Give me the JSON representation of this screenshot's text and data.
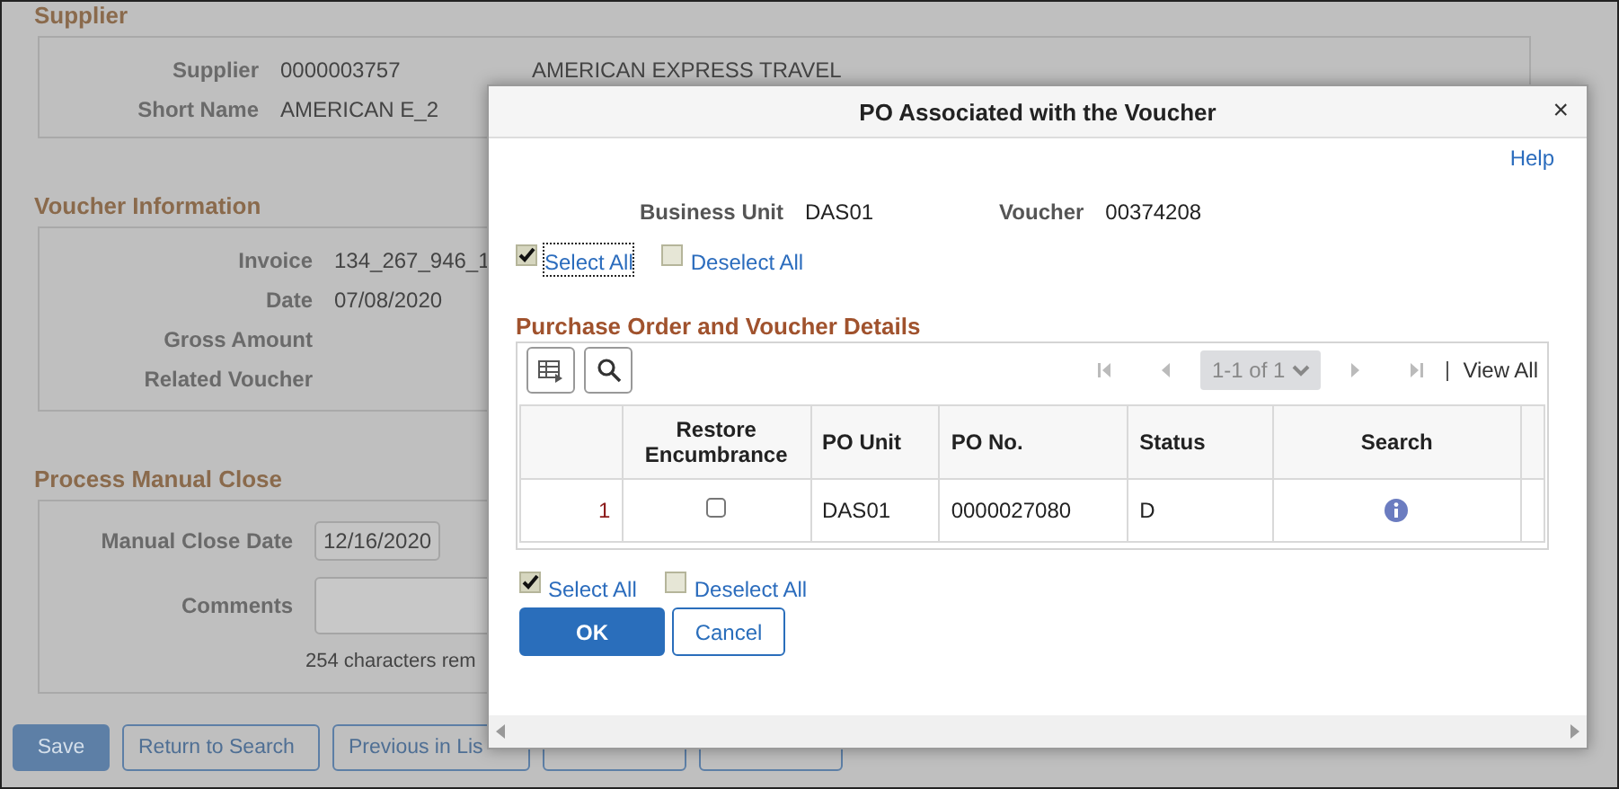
{
  "page": {
    "sections": [
      {
        "title": "Supplier",
        "fields": [
          {
            "label": "Supplier",
            "value": "0000003757",
            "extra": "AMERICAN EXPRESS TRAVEL"
          },
          {
            "label": "Short Name",
            "value": "AMERICAN E_2"
          }
        ]
      },
      {
        "title": "Voucher Information",
        "fields": [
          {
            "label": "Invoice",
            "value": "134_267_946_1"
          },
          {
            "label": "Date",
            "value": "07/08/2020"
          },
          {
            "label": "Gross Amount"
          },
          {
            "label": "Related Voucher"
          }
        ]
      },
      {
        "title": "Process Manual Close",
        "fields": [
          {
            "label": "Manual Close Date",
            "kind": "input",
            "value": "12/16/2020"
          },
          {
            "label": "Comments",
            "kind": "textarea"
          }
        ],
        "note": "254 characters rem"
      }
    ],
    "buttons": [
      {
        "label": "Save",
        "kind": "primary"
      },
      {
        "label": "Return to Search",
        "kind": "secondary"
      },
      {
        "label": "Previous in Lis",
        "kind": "secondary"
      },
      {
        "kind": "secondary"
      },
      {
        "kind": "secondary"
      }
    ]
  },
  "dialog": {
    "title": "PO Associated with the Voucher",
    "close": "×",
    "help": "Help",
    "info": [
      {
        "label": "Business Unit",
        "value": "DAS01"
      },
      {
        "label": "Voucher",
        "value": "00374208"
      }
    ],
    "top_selectors": [
      {
        "label": "Select All",
        "checked": true,
        "focused": true
      },
      {
        "label": "Deselect All",
        "checked": false,
        "focused": false
      }
    ],
    "grid": {
      "title": "Purchase Order and Voucher Details",
      "pager": "1-1 of 1",
      "view_all": "View All",
      "columns": [
        "Restore Encumbrance",
        "PO Unit",
        "PO No.",
        "Status",
        "Search"
      ],
      "rows": [
        {
          "number": "1",
          "restore_encumbrance": false,
          "po_unit": "DAS01",
          "po_no": "0000027080",
          "status": "D"
        }
      ]
    },
    "bottom_selectors": [
      {
        "label": "Select All",
        "checked": true,
        "focused": false
      },
      {
        "label": "Deselect All",
        "checked": false,
        "focused": false
      }
    ],
    "buttons": [
      {
        "label": "OK",
        "kind": "primary"
      },
      {
        "label": "Cancel",
        "kind": "secondary"
      }
    ]
  }
}
